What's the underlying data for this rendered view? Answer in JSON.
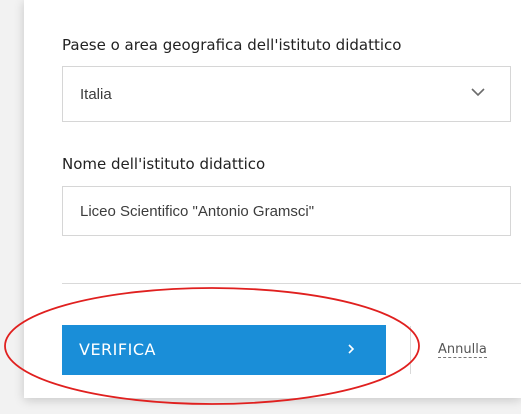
{
  "form": {
    "country_label": "Paese o area geografica dell'istituto didattico",
    "country_value": "Italia",
    "school_label": "Nome dell'istituto didattico",
    "school_value": "Liceo Scientifico \"Antonio Gramsci\""
  },
  "actions": {
    "verify_label": "VERIFICA",
    "cancel_label": "Annulla"
  },
  "colors": {
    "primary": "#1a8ed8",
    "annotation": "#e0201f"
  },
  "icons": {
    "select_chevron": "chevron-down-icon",
    "verify_arrow": "chevron-right-icon"
  }
}
